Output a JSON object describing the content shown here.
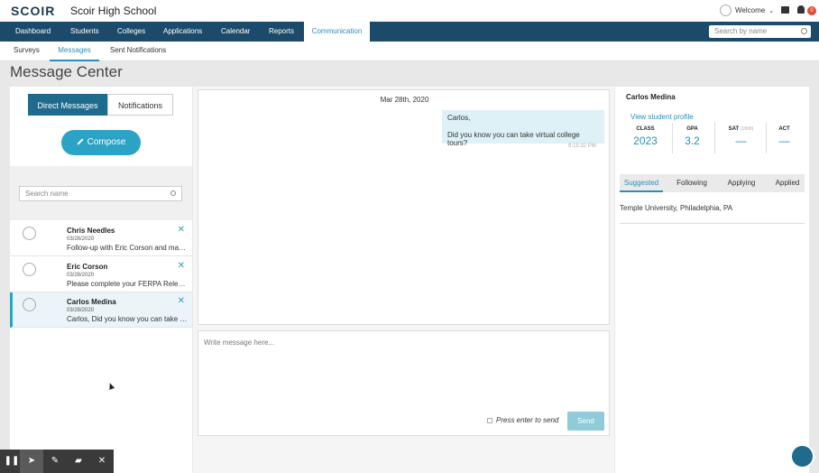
{
  "header": {
    "logo": "SCOIR",
    "school_name": "Scoir High School",
    "welcome": "Welcome",
    "notification_count": "0"
  },
  "nav": {
    "items": [
      {
        "label": "Dashboard"
      },
      {
        "label": "Students"
      },
      {
        "label": "Colleges"
      },
      {
        "label": "Applications"
      },
      {
        "label": "Calendar"
      },
      {
        "label": "Reports"
      },
      {
        "label": "Communication",
        "active": true
      }
    ],
    "search_placeholder": "Search by name"
  },
  "subnav": {
    "items": [
      {
        "label": "Surveys"
      },
      {
        "label": "Messages",
        "active": true
      },
      {
        "label": "Sent Notifications"
      }
    ]
  },
  "page_title": "Message Center",
  "left": {
    "tabs": [
      {
        "label": "Direct Messages",
        "active": true
      },
      {
        "label": "Notifications"
      }
    ],
    "compose_label": "Compose",
    "search_placeholder": "Search name",
    "conversations": [
      {
        "name": "Chris Needles",
        "date": "03/28/2020",
        "preview": "Follow-up with Eric Corson and make sure he completes his survey."
      },
      {
        "name": "Eric Corson",
        "date": "03/28/2020",
        "preview": "Please complete your FERPA Release form."
      },
      {
        "name": "Carlos Medina",
        "date": "03/28/2020",
        "preview": "Carlos, Did you know you can take virtual college tours?",
        "active": true
      }
    ]
  },
  "thread": {
    "date": "Mar 28th, 2020",
    "message_line1": "Carlos,",
    "message_line2": "Did you know you can take virtual college tours?",
    "time": "9:15:32 PM"
  },
  "composer": {
    "placeholder": "Write message here...",
    "enter_label": "Press enter to send",
    "send_label": "Send"
  },
  "student": {
    "name": "Carlos Medina",
    "profile_link": "View student profile",
    "stats": [
      {
        "label": "CLASS",
        "value": "2023"
      },
      {
        "label": "GPA",
        "value": "3.2"
      },
      {
        "label": "SAT",
        "sub": "(1600)",
        "value": "—"
      },
      {
        "label": "ACT",
        "value": "—"
      }
    ],
    "college_tabs": [
      {
        "label": "Suggested",
        "active": true
      },
      {
        "label": "Following"
      },
      {
        "label": "Applying"
      },
      {
        "label": "Applied"
      }
    ],
    "colleges": [
      "Temple University, Philadelphia, PA"
    ]
  },
  "colors": {
    "nav_bg": "#1b4a6b",
    "accent": "#2ba3c4",
    "active_tab": "#1f6b8e"
  }
}
